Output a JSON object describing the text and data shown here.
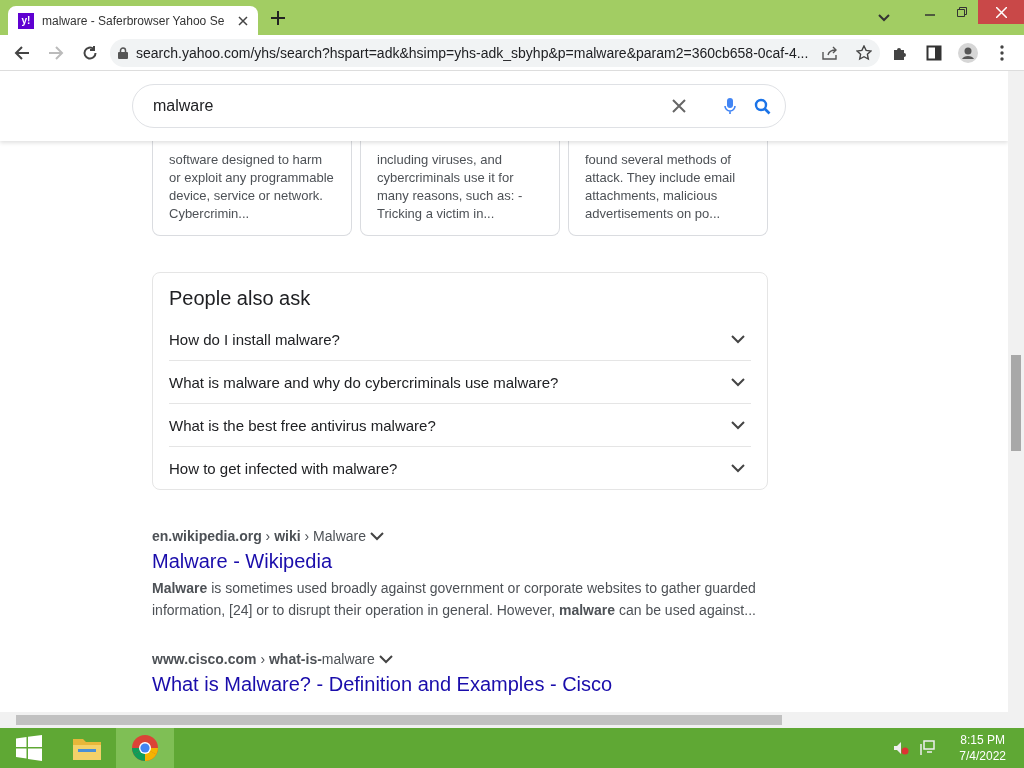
{
  "tab": {
    "title": "malware - Saferbrowser Yahoo Se",
    "favicon": "y!"
  },
  "address_bar": {
    "url": "search.yahoo.com/yhs/search?hspart=adk&hsimp=yhs-adk_sbyhp&p=malware&param2=360cb658-0caf-4..."
  },
  "search": {
    "value": "malware"
  },
  "cards": [
    {
      "text": "software designed to harm or exploit any programmable device, service or network. Cybercrimin..."
    },
    {
      "text": "including viruses, and cybercriminals use it for many reasons, such as: - Tricking a victim in..."
    },
    {
      "text": "found several methods of attack. They include email attachments, malicious advertisements on po..."
    }
  ],
  "people_also_ask": {
    "title": "People also ask",
    "questions": [
      {
        "text": "How do I install malware?",
        "expanded": false
      },
      {
        "text": "What is malware and why do cybercriminals use malware?",
        "expanded": false
      },
      {
        "text": "What is the best free antivirus malware?",
        "expanded": false
      },
      {
        "text": "How to get infected with malware?",
        "expanded": false
      }
    ]
  },
  "results": [
    {
      "breadcrumb": "**en.wikipedia.org** › **wiki** › Malware",
      "title": "Malware - Wikipedia",
      "snippet": "**Malware** is sometimes used broadly against government or corporate websites to gather guarded information, [24] or to disrupt their operation in general. However, **malware** can be used against..."
    },
    {
      "breadcrumb": "**www.cisco.com** › **what-is-**malware",
      "title": "What is Malware? - Definition and Examples - Cisco"
    }
  ],
  "taskbar": {
    "time": "8:15 PM",
    "date": "7/4/2022"
  }
}
